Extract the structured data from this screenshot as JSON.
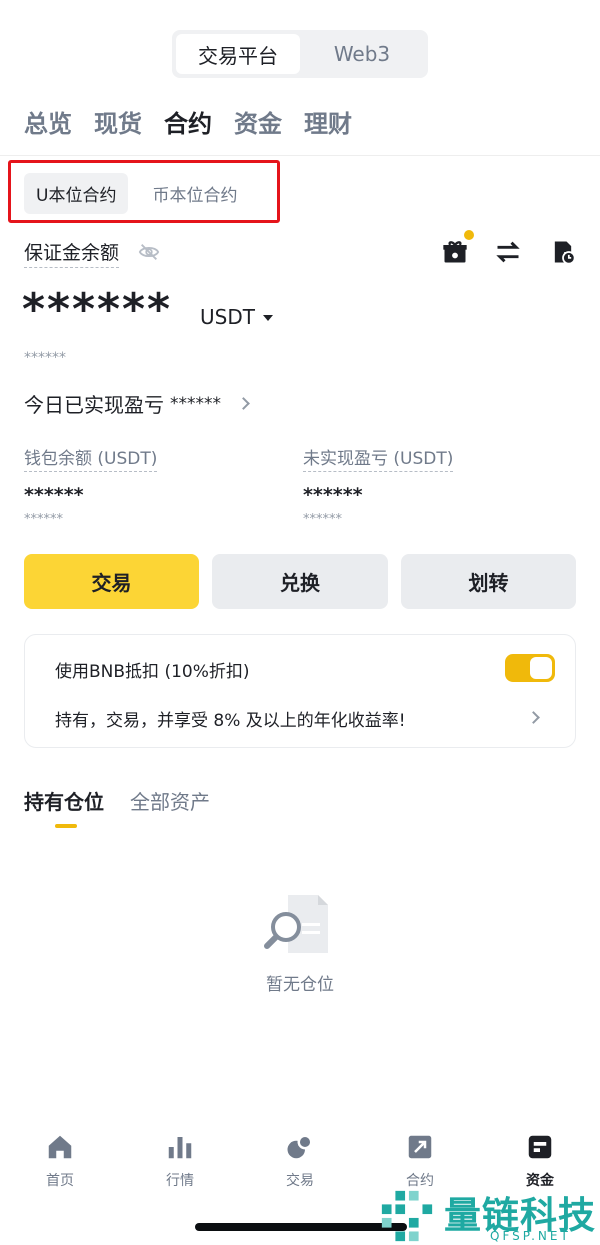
{
  "platform_switch": {
    "items": [
      "交易平台",
      "Web3"
    ],
    "active": 0
  },
  "main_tabs": [
    "总览",
    "现货",
    "合约",
    "资金",
    "理财"
  ],
  "sub_tabs": [
    "U本位合约",
    "币本位合约"
  ],
  "margin": {
    "label": "保证金余额",
    "balance_masked": "******",
    "currency": "USDT",
    "sub_masked": "******"
  },
  "pnl_today": {
    "label": "今日已实现盈亏",
    "value": "******"
  },
  "wallet": {
    "label": "钱包余额 (USDT)",
    "value": "******",
    "sub": "******"
  },
  "unrealized": {
    "label": "未实现盈亏 (USDT)",
    "value": "******",
    "sub": "******"
  },
  "actions": {
    "trade": "交易",
    "convert": "兑换",
    "transfer": "划转"
  },
  "bnb_card": {
    "title": "使用BNB抵扣 (10%折扣)",
    "desc": "持有，交易，并享受 8% 及以上的年化收益率!",
    "toggle_on": true,
    "accent_color": "#f0b90b"
  },
  "position_tabs": [
    "持有仓位",
    "全部资产"
  ],
  "empty_state": "暂无仓位",
  "bottom_nav": [
    {
      "label": "首页",
      "icon": "home-icon"
    },
    {
      "label": "行情",
      "icon": "market-icon"
    },
    {
      "label": "交易",
      "icon": "trade-icon"
    },
    {
      "label": "合约",
      "icon": "futures-icon"
    },
    {
      "label": "资金",
      "icon": "wallet-icon"
    }
  ],
  "watermark": {
    "text": "量链科技",
    "sub": "QFSP.NET"
  }
}
